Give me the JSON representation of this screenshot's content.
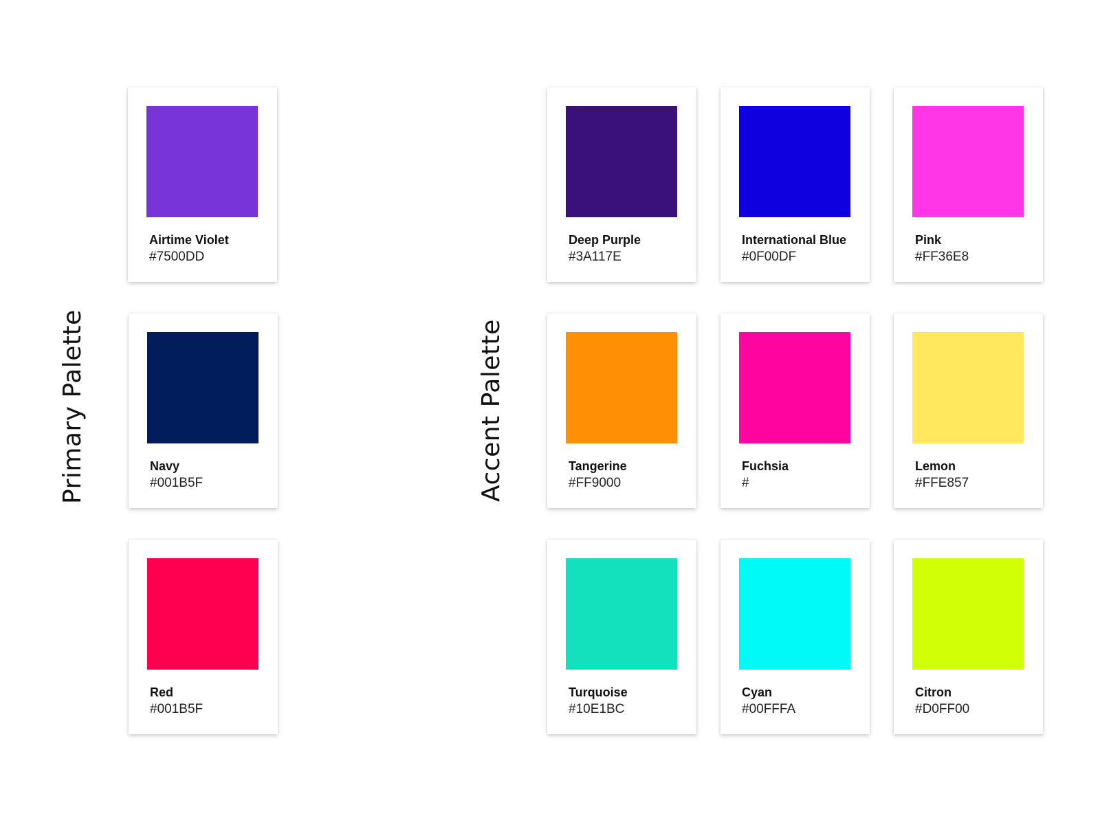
{
  "primary": {
    "title": "Primary Palette",
    "swatches": [
      {
        "name": "Airtime Violet",
        "hex": "#7500DD",
        "color": "#7834D9"
      },
      {
        "name": "Navy",
        "hex": "#001B5F",
        "color": "#021D5C"
      },
      {
        "name": "Red",
        "hex": "#001B5F",
        "color": "#FF0050"
      }
    ]
  },
  "accent": {
    "title": "Accent Palette",
    "swatches": [
      {
        "name": "Deep Purple",
        "hex": "#3A117E",
        "color": "#3A117A"
      },
      {
        "name": "International Blue",
        "hex": "#0F00DF",
        "color": "#0F00DF"
      },
      {
        "name": "Pink",
        "hex": "#FF36E8",
        "color": "#FF36E8"
      },
      {
        "name": "Tangerine",
        "hex": "#FF9000",
        "color": "#FF9006"
      },
      {
        "name": "Fuchsia",
        "hex": "#",
        "color": "#FF06A0"
      },
      {
        "name": "Lemon",
        "hex": "#FFE857",
        "color": "#FFE85E"
      },
      {
        "name": "Turquoise",
        "hex": "#10E1BC",
        "color": "#13E0BC"
      },
      {
        "name": "Cyan",
        "hex": "#00FFFA",
        "color": "#00FBF7"
      },
      {
        "name": "Citron",
        "hex": "#D0FF00",
        "color": "#D0FF06"
      }
    ]
  }
}
